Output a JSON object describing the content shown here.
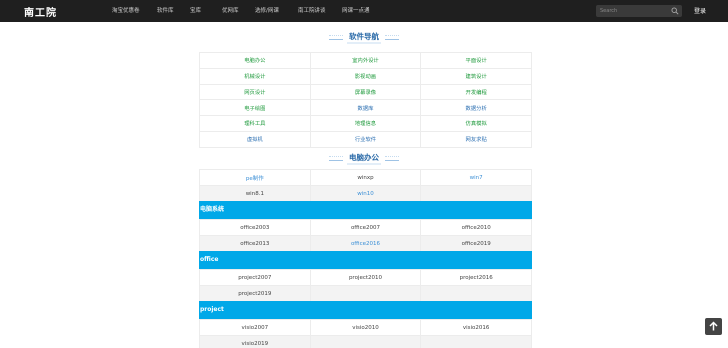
{
  "header": {
    "logo": "南工院",
    "nav": [
      "淘宝优惠卷",
      "软件库",
      "宝库",
      "优网库",
      "选修/网课",
      "南工院讲谈",
      "网课一点通"
    ],
    "search_placeholder": "Search",
    "login_label": "登录"
  },
  "software_nav": {
    "title": "软件导航",
    "rows": [
      [
        {
          "t": "电脑办公",
          "c": "g"
        },
        {
          "t": "室内外设计",
          "c": "g"
        },
        {
          "t": "平面设计",
          "c": "g"
        }
      ],
      [
        {
          "t": "机械设计",
          "c": "g"
        },
        {
          "t": "影视动画",
          "c": "g"
        },
        {
          "t": "建筑设计",
          "c": "g"
        }
      ],
      [
        {
          "t": "网页设计",
          "c": "g"
        },
        {
          "t": "屏幕录像",
          "c": "g"
        },
        {
          "t": "开发编程",
          "c": "g"
        }
      ],
      [
        {
          "t": "电子绘图",
          "c": "g"
        },
        {
          "t": "数据库",
          "c": "b"
        },
        {
          "t": "数据分析",
          "c": "b"
        }
      ],
      [
        {
          "t": "理科工具",
          "c": "g"
        },
        {
          "t": "地理信息",
          "c": "g"
        },
        {
          "t": "仿真模拟",
          "c": "g"
        }
      ],
      [
        {
          "t": "虚拟机",
          "c": "b"
        },
        {
          "t": "行业软件",
          "c": "b"
        },
        {
          "t": "网友求贴",
          "c": "b"
        }
      ]
    ]
  },
  "office": {
    "title": "电脑办公",
    "os_rows": [
      [
        {
          "t": "pe制作",
          "link": true
        },
        {
          "t": "winxp",
          "link": false
        },
        {
          "t": "win7",
          "link": true
        }
      ],
      [
        {
          "t": "win8.1",
          "link": false
        },
        {
          "t": "win10",
          "link": true
        },
        {
          "t": "",
          "link": false
        }
      ]
    ],
    "band1": "电脑系统",
    "office_rows": [
      [
        {
          "t": "office2003",
          "link": false
        },
        {
          "t": "office2007",
          "link": false
        },
        {
          "t": "office2010",
          "link": false
        }
      ],
      [
        {
          "t": "office2013",
          "link": false
        },
        {
          "t": "office2016",
          "link": true
        },
        {
          "t": "office2019",
          "link": false
        }
      ]
    ],
    "band2": "office",
    "project_rows": [
      [
        {
          "t": "project2007",
          "link": false
        },
        {
          "t": "project2010",
          "link": false
        },
        {
          "t": "project2016",
          "link": false
        }
      ],
      [
        {
          "t": "project2019",
          "link": false
        },
        {
          "t": "",
          "link": false
        },
        {
          "t": "",
          "link": false
        }
      ]
    ],
    "band3": "project",
    "visio_rows": [
      [
        {
          "t": "visio2007",
          "link": false
        },
        {
          "t": "visio2010",
          "link": false
        },
        {
          "t": "visio2016",
          "link": false
        }
      ],
      [
        {
          "t": "visio2019",
          "link": false
        },
        {
          "t": "",
          "link": false
        },
        {
          "t": "",
          "link": false
        }
      ]
    ]
  }
}
